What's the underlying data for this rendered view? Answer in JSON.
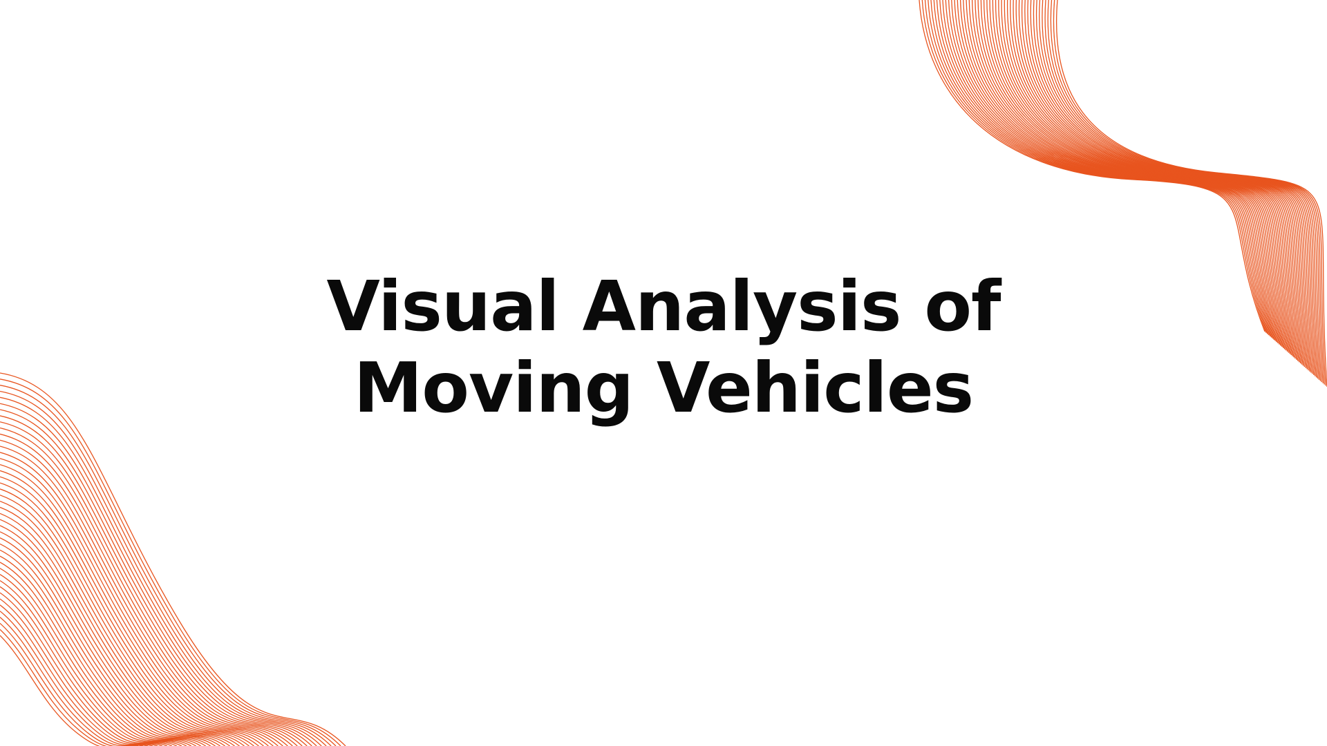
{
  "slide": {
    "title_line_1": "Visual Analysis of",
    "title_line_2": "Moving Vehicles"
  },
  "theme": {
    "background": "#ffffff",
    "text_color": "#0a0a0a",
    "accent": "#e8541e"
  },
  "decorations": [
    {
      "name": "top-right-wave-lines",
      "icon": "line-wave-graphic"
    },
    {
      "name": "bottom-left-wave-lines",
      "icon": "line-wave-graphic"
    }
  ]
}
